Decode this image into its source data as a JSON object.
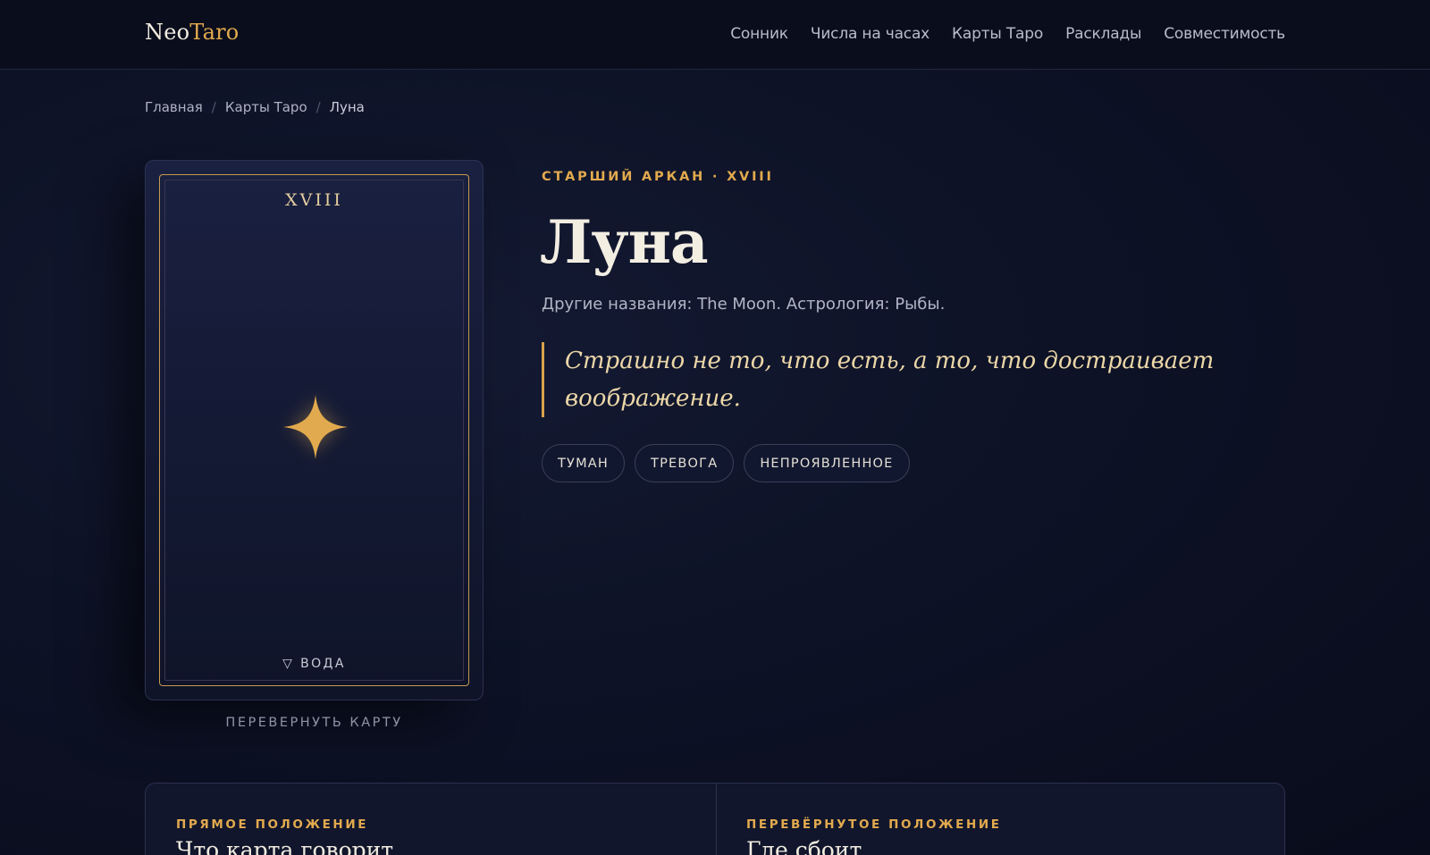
{
  "header": {
    "logo_main": "Neo",
    "logo_accent": "Taro",
    "nav": [
      "Сонник",
      "Числа на часах",
      "Карты Таро",
      "Расклады",
      "Совместимость"
    ]
  },
  "breadcrumb": {
    "items": [
      "Главная",
      "Карты Таро",
      "Луна"
    ],
    "separator": "/"
  },
  "card": {
    "numeral": "XVIII",
    "element_label": "▽ ВОДА",
    "flip_label": "ПЕРЕВЕРНУТЬ КАРТУ",
    "symbol_icon": "four-point-star-icon"
  },
  "info": {
    "eyebrow": "СТАРШИЙ АРКАН · XVIII",
    "title": "Луна",
    "subtitle": "Другие названия: The Moon. Астрология: Рыбы.",
    "quote": "Страшно не то, что есть, а то, что достраивает воображение.",
    "tags": [
      "ТУМАН",
      "ТРЕВОГА",
      "НЕПРОЯВЛЕННОЕ"
    ]
  },
  "positions": {
    "upright_eyebrow": "ПРЯМОЕ ПОЛОЖЕНИЕ",
    "upright_heading": "Что карта говорит",
    "reversed_eyebrow": "ПЕРЕВЁРНУТОЕ ПОЛОЖЕНИЕ",
    "reversed_heading": "Где сбоит"
  },
  "colors": {
    "accent": "#e2aa4e",
    "background": "#0d1226",
    "quote_text": "#ecd7a8"
  }
}
